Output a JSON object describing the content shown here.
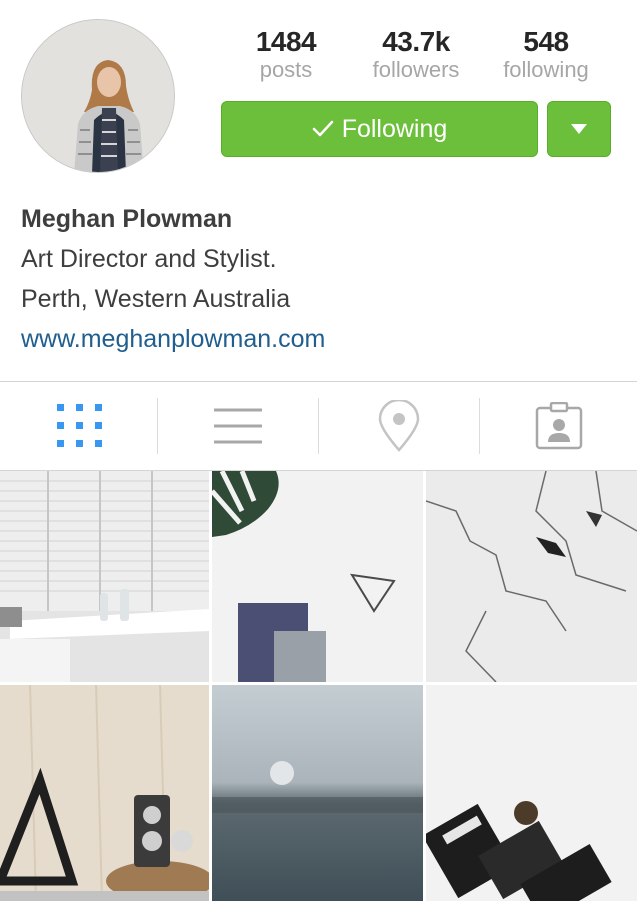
{
  "profile": {
    "name": "Meghan Plowman",
    "bio_line_1": "Art Director and Stylist.",
    "bio_line_2": "Perth, Western Australia",
    "website": "www.meghanplowman.com"
  },
  "stats": {
    "posts": {
      "value": "1484",
      "label": "posts"
    },
    "followers": {
      "value": "43.7k",
      "label": "followers"
    },
    "following": {
      "value": "548",
      "label": "following"
    }
  },
  "actions": {
    "follow_label": "Following",
    "accent_color": "#6bbf3a"
  },
  "tabs": [
    {
      "icon": "grid-icon",
      "active": true
    },
    {
      "icon": "list-icon",
      "active": false
    },
    {
      "icon": "location-pin-icon",
      "active": false
    },
    {
      "icon": "tagged-photos-icon",
      "active": false
    }
  ],
  "colors": {
    "link": "#1f5e8e",
    "active_tab": "#3897f0",
    "inactive_tab": "#a8a8a8"
  }
}
